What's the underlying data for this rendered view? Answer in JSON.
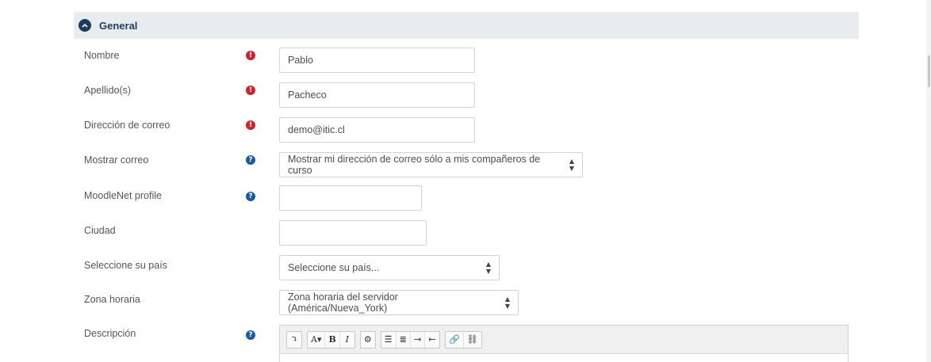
{
  "section": {
    "title": "General",
    "icon": "chevron-up-icon"
  },
  "fields": {
    "nombre": {
      "label": "Nombre",
      "value": "Pablo"
    },
    "apellidos": {
      "label": "Apellido(s)",
      "value": "Pacheco"
    },
    "correo": {
      "label": "Dirección de correo",
      "value": "demo@itic.cl"
    },
    "mostrar_correo": {
      "label": "Mostrar correo",
      "selected": "Mostrar mi dirección de correo sólo a mis compañeros de curso"
    },
    "moodlenet": {
      "label": "MoodleNet profile",
      "value": ""
    },
    "ciudad": {
      "label": "Ciudad",
      "value": ""
    },
    "pais": {
      "label": "Seleccione su país",
      "selected": "Seleccione su país..."
    },
    "zona_horaria": {
      "label": "Zona horaria",
      "selected": "Zona horaria del servidor (América/Nueva_York)"
    },
    "descripcion": {
      "label": "Descripción"
    }
  },
  "badges": {
    "required": "!",
    "help": "?"
  },
  "toolbar": {
    "buttons": [
      "↴",
      "A▾",
      "B",
      "I",
      "⚙",
      "☰",
      "≣",
      "⇥",
      "⇤",
      "🔗",
      "⛓"
    ],
    "icons": [
      "collapse-toolbar-icon",
      "font-color-icon",
      "bold-icon",
      "italic-icon",
      "settings-icon",
      "unordered-list-icon",
      "ordered-list-icon",
      "indent-icon",
      "outdent-icon",
      "link-icon",
      "unlink-icon"
    ]
  },
  "colors": {
    "required": "#c9252c",
    "help": "#1b5a9c",
    "header_bg": "#e9ecef",
    "accent": "#1f3b5c"
  }
}
